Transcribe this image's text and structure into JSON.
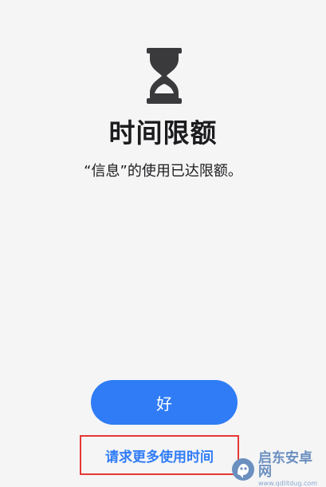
{
  "screen": {
    "title": "时间限额",
    "message": "“信息”的使用已达限额。",
    "ok_label": "好",
    "request_label": "请求更多使用时间"
  },
  "watermark": {
    "name": "启东安卓网",
    "url": "www.qdlitdug.com"
  },
  "colors": {
    "accent": "#2f7cf6",
    "highlight_border": "#e53935",
    "background": "#f5f5f6",
    "icon": "#3a3a3c"
  },
  "icons": {
    "hourglass": "hourglass-icon"
  }
}
